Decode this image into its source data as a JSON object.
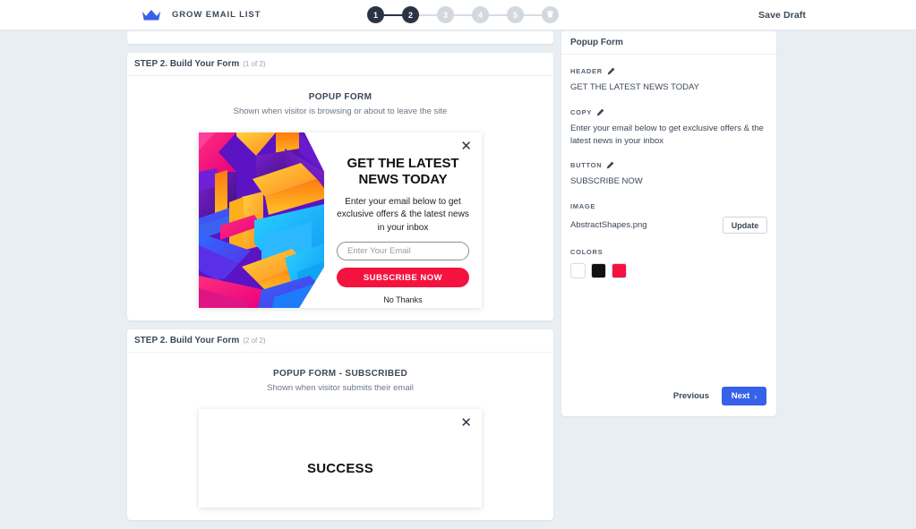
{
  "topbar": {
    "logo_icon": "crown-icon",
    "brand_name": "GROW EMAIL LIST",
    "save_draft_label": "Save Draft",
    "stepper": {
      "steps": [
        {
          "label": "1",
          "state": "active"
        },
        {
          "label": "2",
          "state": "active"
        },
        {
          "label": "3",
          "state": "inactive"
        },
        {
          "label": "4",
          "state": "inactive"
        },
        {
          "label": "5",
          "state": "inactive"
        },
        {
          "label": "♛",
          "state": "inactive",
          "icon": "trophy-icon"
        }
      ]
    }
  },
  "cards": [
    {
      "head_title": "STEP 2. Build Your Form",
      "head_sub": "(1 of 2)",
      "preview_title": "POPUP FORM",
      "preview_sub": "Shown when visitor is browsing or about to leave the site"
    },
    {
      "head_title": "STEP 2. Build Your Form",
      "head_sub": "(2 of 2)",
      "preview_title": "POPUP FORM - SUBSCRIBED",
      "preview_sub": "Shown when visitor submits their email"
    }
  ],
  "popup": {
    "close_icon": "close-icon",
    "headline": "GET THE LATEST NEWS TODAY",
    "copy": "Enter your email below to get exclusive offers & the latest news in your inbox",
    "input_placeholder": "Enter Your Email",
    "button_label": "SUBSCRIBE NOW",
    "decline_label": "No Thanks",
    "button_color": "#F4133F"
  },
  "popup_success": {
    "close_icon": "close-icon",
    "headline": "SUCCESS"
  },
  "panel": {
    "title": "Popup Form",
    "fields": [
      {
        "label": "HEADER",
        "edit_icon": "pencil-icon",
        "value": "GET THE LATEST NEWS TODAY"
      },
      {
        "label": "COPY",
        "edit_icon": "pencil-icon",
        "value": "Enter your email below to get exclusive offers & the latest news in your inbox"
      },
      {
        "label": "BUTTON",
        "edit_icon": "pencil-icon",
        "value": "SUBSCRIBE NOW"
      }
    ],
    "image": {
      "label": "IMAGE",
      "filename": "AbstractShapes.png",
      "update_label": "Update"
    },
    "colors": {
      "label": "COLORS",
      "swatches": [
        "#FFFFFF",
        "#111111",
        "#F4133F"
      ]
    },
    "previous_label": "Previous",
    "next_label": "Next",
    "next_chevron": "›",
    "next_color": "#3761E8"
  }
}
